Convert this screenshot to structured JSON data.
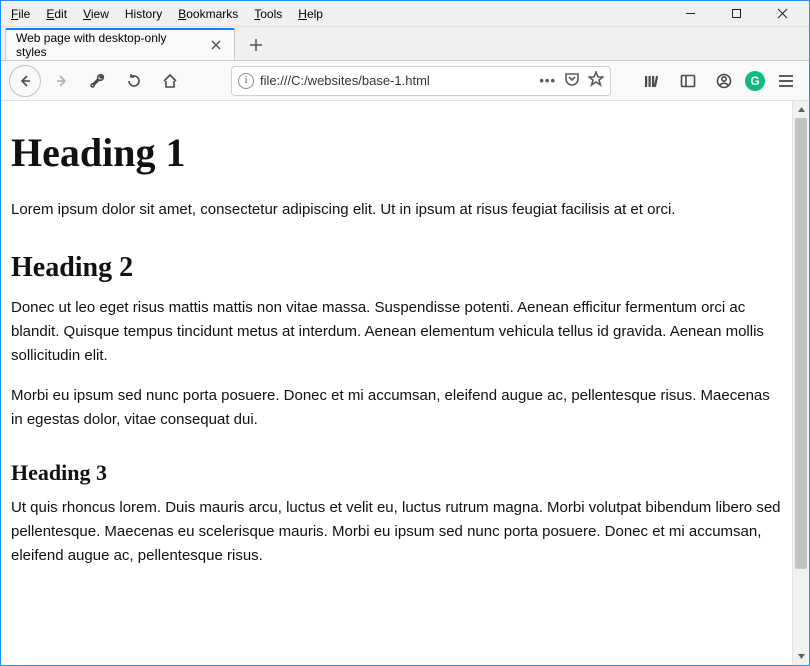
{
  "menubar": {
    "file": "File",
    "edit": "Edit",
    "view": "View",
    "history": "History",
    "bookmarks": "Bookmarks",
    "tools": "Tools",
    "help": "Help"
  },
  "tab": {
    "title": "Web page with desktop-only styles"
  },
  "addressbar": {
    "url": "file:///C:/websites/base-1.html"
  },
  "page": {
    "h1": "Heading 1",
    "p1": "Lorem ipsum dolor sit amet, consectetur adipiscing elit. Ut in ipsum at risus feugiat facilisis at et orci.",
    "h2": "Heading 2",
    "p2": "Donec ut leo eget risus mattis mattis non vitae massa. Suspendisse potenti. Aenean efficitur fermentum orci ac blandit. Quisque tempus tincidunt metus at interdum. Aenean elementum vehicula tellus id gravida. Aenean mollis sollicitudin elit.",
    "p3": "Morbi eu ipsum sed nunc porta posuere. Donec et mi accumsan, eleifend augue ac, pellentesque risus. Maecenas in egestas dolor, vitae consequat dui.",
    "h3": "Heading 3",
    "p4": "Ut quis rhoncus lorem. Duis mauris arcu, luctus et velit eu, luctus rutrum magna. Morbi volutpat bibendum libero sed pellentesque. Maecenas eu scelerisque mauris. Morbi eu ipsum sed nunc porta posuere. Donec et mi accumsan, eleifend augue ac, pellentesque risus."
  }
}
